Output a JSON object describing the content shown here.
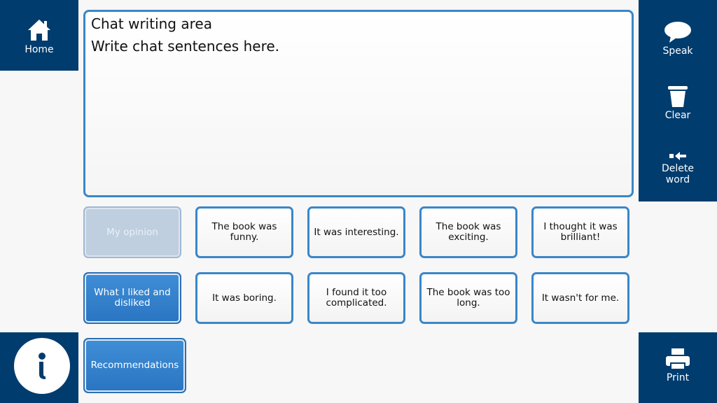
{
  "nav": {
    "home_label": "Home",
    "speak_label": "Speak",
    "clear_label": "Clear",
    "delete_word_label": "Delete word",
    "print_label": "Print",
    "info_icon": "info-icon"
  },
  "chat": {
    "title": "Chat writing area",
    "text": "Write chat sentences here."
  },
  "categories": [
    {
      "label": "My opinion",
      "state": "disabled"
    },
    {
      "label": "What I liked and disliked",
      "state": "active"
    },
    {
      "label": "Recommendations",
      "state": "active"
    }
  ],
  "phrases": [
    [
      "The book was funny.",
      "It was interesting.",
      "The book was exciting.",
      "I thought it was brilliant!"
    ],
    [
      "It was boring.",
      "I found it too complicated.",
      "The book was too long.",
      "It wasn't for me."
    ]
  ],
  "colors": {
    "navy": "#003c6e",
    "accent_blue": "#3a86c8",
    "category_blue": "#2a75c2"
  }
}
